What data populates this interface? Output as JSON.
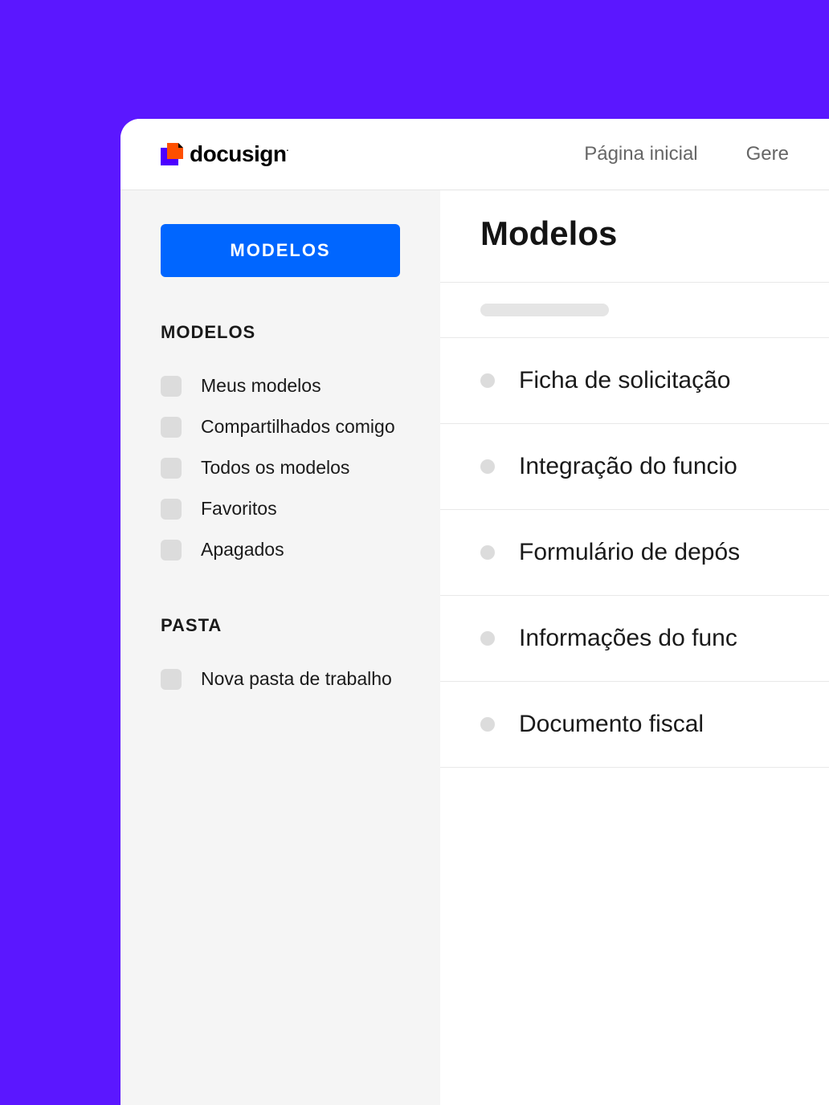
{
  "brand": {
    "name": "docusign"
  },
  "header": {
    "nav": [
      {
        "label": "Página inicial"
      },
      {
        "label": "Gere"
      }
    ]
  },
  "sidebar": {
    "primary_button": "MODELOS",
    "section1_heading": "MODELOS",
    "items": [
      {
        "label": "Meus modelos"
      },
      {
        "label": "Compartilhados comigo"
      },
      {
        "label": "Todos os modelos"
      },
      {
        "label": "Favoritos"
      },
      {
        "label": "Apagados"
      }
    ],
    "section2_heading": "PASTA",
    "folders": [
      {
        "label": "Nova pasta de trabalho"
      }
    ]
  },
  "main": {
    "title": "Modelos",
    "rows": [
      {
        "title": "Ficha de solicitação"
      },
      {
        "title": "Integração do funcio"
      },
      {
        "title": "Formulário de depós"
      },
      {
        "title": "Informações do func"
      },
      {
        "title": "Documento fiscal"
      }
    ]
  }
}
